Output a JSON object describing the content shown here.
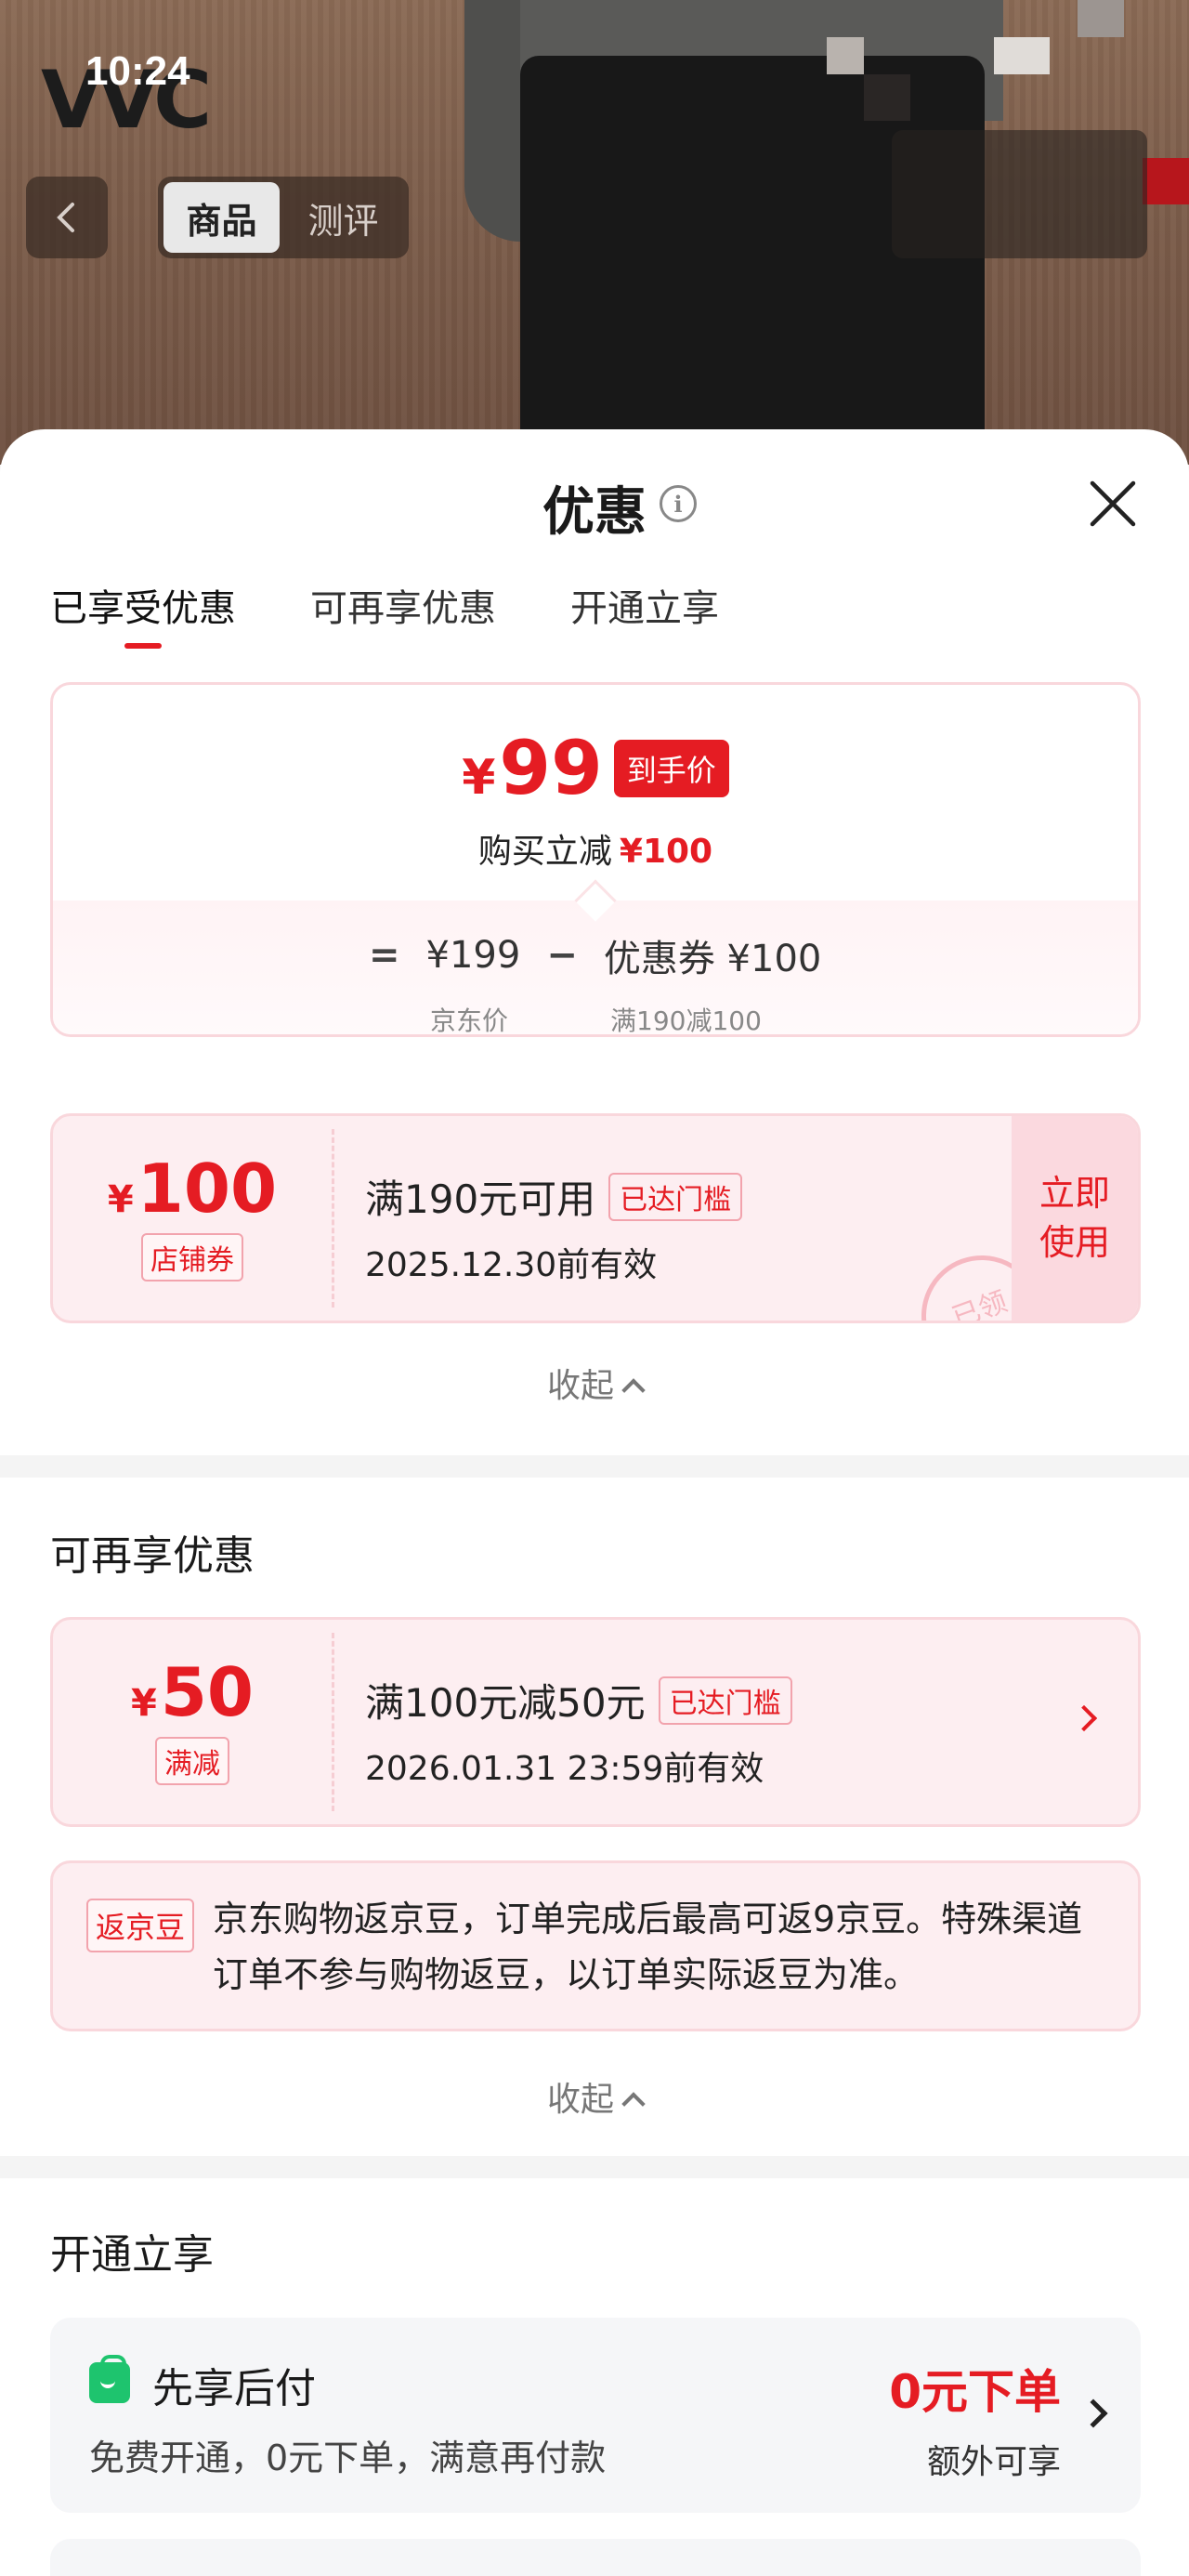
{
  "status_bar": {
    "time": "10:24"
  },
  "hero": {
    "brand": "VVC",
    "tabs": [
      "商品",
      "测评"
    ],
    "active_tab": 0
  },
  "sheet": {
    "title": "优惠",
    "tabs": [
      "已享受优惠",
      "可再享优惠",
      "开通立享"
    ],
    "active_tab": 0
  },
  "summary": {
    "price_symbol": "¥",
    "final_price": "99",
    "final_tag": "到手价",
    "reduce_label": "购买立减",
    "reduce_amount": "¥100",
    "eq": "=",
    "original_price": "¥199",
    "minus": "−",
    "coupon_part": "优惠券 ¥100",
    "original_label": "京东价",
    "coupon_label": "满190减100"
  },
  "coupon_used": {
    "symbol": "¥",
    "amount": "100",
    "type": "店铺券",
    "title": "满190元可用",
    "badge": "已达门槛",
    "valid": "2025.12.30前有效",
    "button": "立即\n使用",
    "stamp": "已领"
  },
  "collapse1": "收起",
  "more_section": {
    "title": "可再享优惠",
    "coupon": {
      "symbol": "¥",
      "amount": "50",
      "type": "满减",
      "title": "满100元减50元",
      "badge": "已达门槛",
      "valid": "2026.01.31 23:59前有效"
    },
    "bean": {
      "tag": "返京豆",
      "text": "京东购物返京豆，订单完成后最高可返9京豆。特殊渠道订单不参与购物返豆，以订单实际返豆为准。"
    },
    "collapse": "收起"
  },
  "open_section": {
    "title": "开通立享",
    "pay": {
      "title": "先享后付",
      "desc": "免费开通，0元下单，满意再付款",
      "highlight": "0元下单",
      "sub": "额外可享"
    }
  },
  "colors": {
    "accent": "#e51c23",
    "pay_green": "#1ec46e"
  }
}
